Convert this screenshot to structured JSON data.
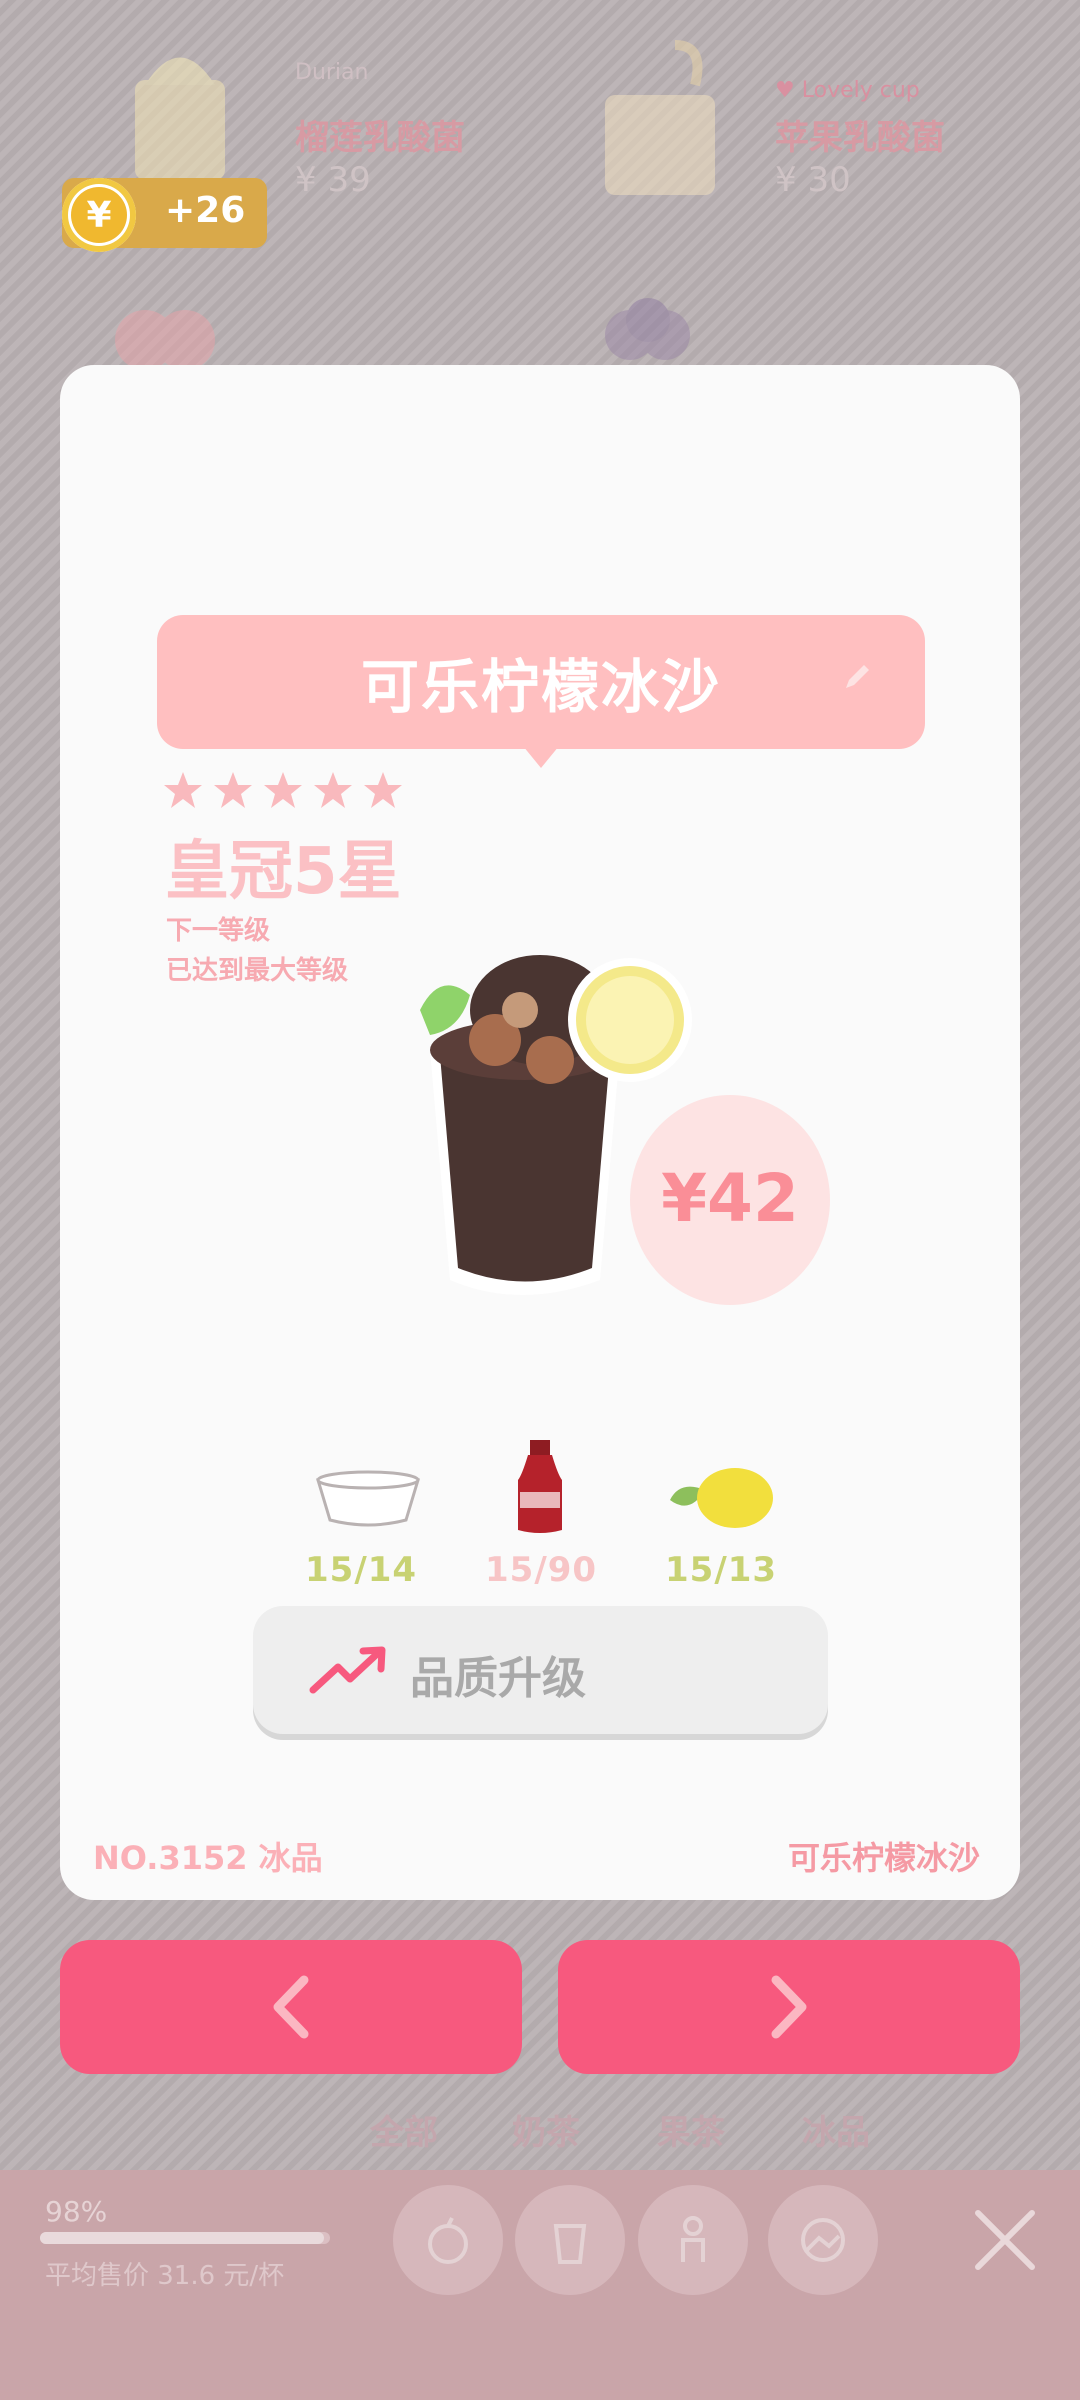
{
  "background": {
    "items": [
      {
        "tag": "Durian",
        "name": "榴莲乳酸菌",
        "price": "¥ 39"
      },
      {
        "tag": "Lovely cup",
        "name": "苹果乳酸菌",
        "price": "¥ 30"
      }
    ]
  },
  "coins": {
    "icon": "yen-coin-icon",
    "symbol": "¥",
    "delta": "+26"
  },
  "drink": {
    "name": "可乐柠檬冰沙",
    "stars": 5,
    "rank": "皇冠5星",
    "next_label": "下一等级",
    "next_value": "已达到最大等级",
    "price": "¥42"
  },
  "ingredients": [
    {
      "icon": "ice-bowl-icon",
      "count": "15/14",
      "color": "#c8d273"
    },
    {
      "icon": "cola-bottle-icon",
      "count": "15/90",
      "color": "#f7c5c6"
    },
    {
      "icon": "lemon-icon",
      "count": "15/13",
      "color": "#c8d273"
    }
  ],
  "upgrade_button": {
    "label": "品质升级",
    "icon": "trend-up-icon"
  },
  "footer": {
    "number": "NO.3152 冰品",
    "name": "可乐柠檬冰沙"
  },
  "nav": {
    "prev": "chevron-left-icon",
    "next": "chevron-right-icon"
  },
  "tabs": [
    "全部",
    "奶茶",
    "果茶",
    "冰品"
  ],
  "stats": {
    "percent": "98%",
    "progress": 0.98,
    "avg_price": "平均售价 31.6 元/杯"
  },
  "colors": {
    "accent": "#f7597e",
    "bubble": "#ffbfc0",
    "rank": "#fbc0c4",
    "coin": "#d9a94a"
  }
}
